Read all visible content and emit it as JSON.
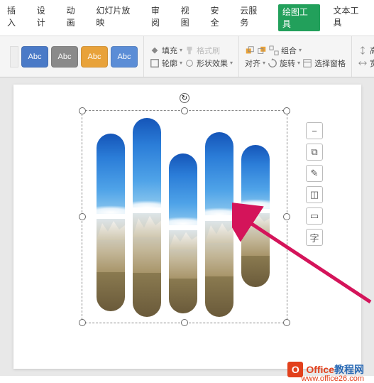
{
  "menu": {
    "insert": "插入",
    "design": "设计",
    "animation": "动画",
    "slideshow": "幻灯片放映",
    "review": "审阅",
    "view": "视图",
    "security": "安全",
    "cloud": "云服务",
    "drawtools": "绘图工具",
    "texttools": "文本工具"
  },
  "ribbon": {
    "abc": "Abc",
    "fill": "填充",
    "format": "格式刷",
    "outline": "轮廓",
    "effects": "形状效果",
    "align": "对齐",
    "rotate": "旋转",
    "group": "组合",
    "selectpane": "选择窗格",
    "height": "高",
    "width": "宽"
  },
  "sideTools": {
    "minus": "−",
    "copy": "⧉",
    "pen": "✎",
    "shape": "◫",
    "rect": "▭",
    "text": "字"
  },
  "watermark": {
    "title1": "Office",
    "title2": "教程网",
    "url": "www.office26.com",
    "badge": "O"
  }
}
